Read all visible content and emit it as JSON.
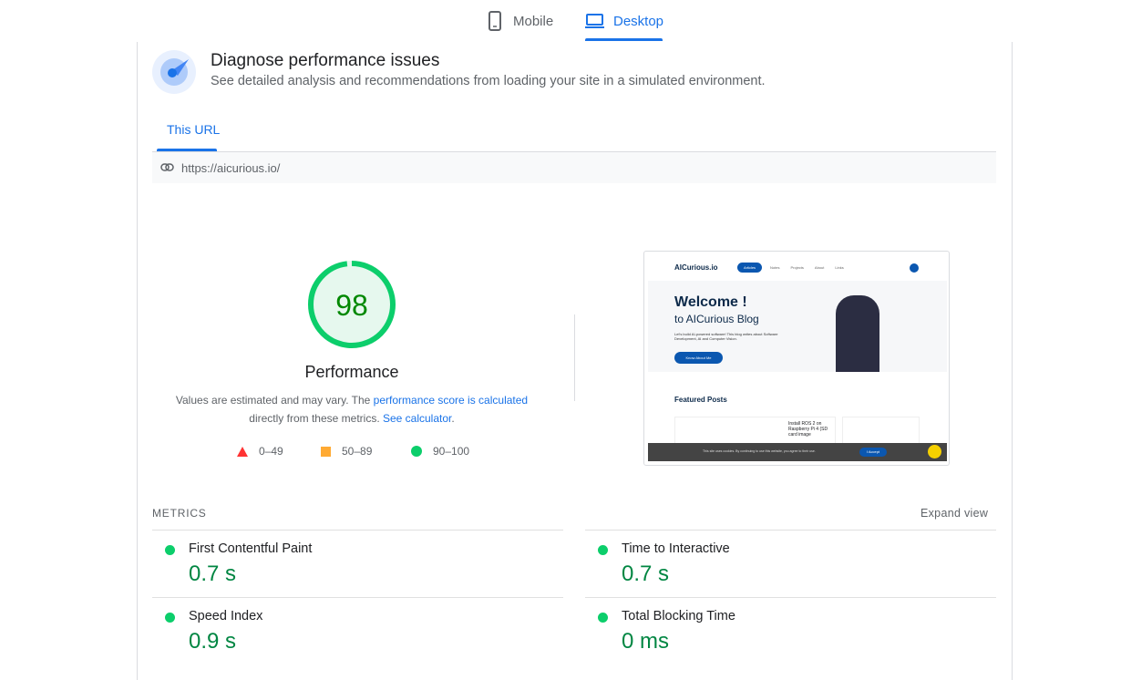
{
  "tabs": [
    {
      "label": "Mobile",
      "icon": "phone-icon"
    },
    {
      "label": "Desktop",
      "icon": "laptop-icon"
    }
  ],
  "header": {
    "title": "Diagnose performance issues",
    "subtitle": "See detailed analysis and recommendations from loading your site in a simulated environment."
  },
  "url_tab": "This URL",
  "url": "https://aicurious.io/",
  "score": {
    "value": "98",
    "percent": 98,
    "label": "Performance",
    "color": "#0cce6b",
    "text_color": "#008800",
    "note_pre": "Values are estimated and may vary. The ",
    "note_link1": "performance score is calculated",
    "note_mid": "directly from these metrics. ",
    "note_link2": "See calculator",
    "note_post": "."
  },
  "legend": [
    {
      "range": "0–49",
      "color": "#ff3333"
    },
    {
      "range": "50–89",
      "color": "#ffaa33"
    },
    {
      "range": "90–100",
      "color": "#0cce6b"
    }
  ],
  "screenshot": {
    "logo": "AICurious.io",
    "nav": [
      "Articles",
      "Notes",
      "Projects",
      "About",
      "Links"
    ],
    "welcome": "Welcome !",
    "blog": "to AICurious Blog",
    "intro": "Let's build AI-powered software! This blog writes about Software Development, AI and Computer Vision.",
    "button": "Know About Me",
    "featured": "Featured Posts",
    "post": "Install ROS 2 on Raspberry Pi 4 (SD card image",
    "cookie": "This site uses cookies. By continuing to use this website, you agree to their use.",
    "accept": "I Accept"
  },
  "metrics": {
    "title": "METRICS",
    "expand": "Expand view",
    "items": [
      {
        "label": "First Contentful Paint",
        "value": "0.7 s"
      },
      {
        "label": "Time to Interactive",
        "value": "0.7 s"
      },
      {
        "label": "Speed Index",
        "value": "0.9 s"
      },
      {
        "label": "Total Blocking Time",
        "value": "0 ms"
      }
    ]
  }
}
